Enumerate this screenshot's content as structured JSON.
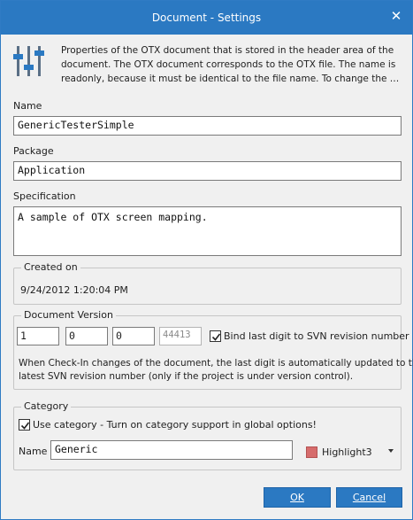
{
  "window": {
    "title": "Document - Settings",
    "close_symbol": "✕"
  },
  "intro": {
    "line1": "Properties of the OTX document that is stored in the header area of the",
    "line2": "document. The OTX document corresponds to the OTX file. The name is",
    "line3": "readonly, because it must be identical to the file name. To change the file na..."
  },
  "fields": {
    "name_label": "Name",
    "name_value": "GenericTesterSimple",
    "package_label": "Package",
    "package_value": "Application",
    "specification_label": "Specification",
    "specification_value": "A sample of OTX screen mapping."
  },
  "created": {
    "title": "Created on",
    "value": "9/24/2012 1:20:04 PM"
  },
  "version": {
    "title": "Document Version",
    "parts": [
      "1",
      "0",
      "0",
      "44413"
    ],
    "bind_label": "Bind last digit to SVN revision number",
    "bind_checked": true,
    "note_line1": "When Check-In changes of the document, the last digit is automatically updated to the",
    "note_line2": "latest SVN revision number (only if the project is under version control)."
  },
  "category": {
    "title": "Category",
    "use_label": "Use category - Turn on category support in global options!",
    "use_checked": true,
    "name_label": "Name",
    "name_value": "Generic",
    "highlight_value": "Highlight3",
    "highlight_color": "#d66c6c"
  },
  "buttons": {
    "ok": "OK",
    "cancel": "Cancel"
  },
  "colors": {
    "accent": "#2b79c2"
  },
  "icons": {
    "header": "settings-sliders-icon",
    "close": "close-icon",
    "checkbox": "checkmark-icon",
    "dropdown": "chevron-down-icon"
  }
}
